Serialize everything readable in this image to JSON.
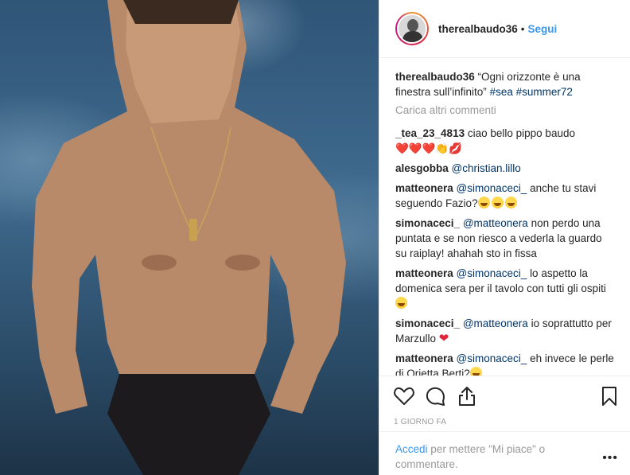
{
  "header": {
    "username": "therealbaudo36",
    "separator": "•",
    "follow_label": "Segui"
  },
  "caption": {
    "username": "therealbaudo36",
    "text": "“Ogni orizzonte è una finestra sull’infinito”",
    "hashtags": [
      "#sea",
      "#summer72"
    ]
  },
  "load_more_label": "Carica altri commenti",
  "comments": [
    {
      "user": "_tea_23_4813",
      "text": "ciao bello pippo baudo",
      "emoji": "❤️❤️❤️👏💋"
    },
    {
      "user": "alesgobba",
      "mention": "@christian.lillo",
      "text": ""
    },
    {
      "user": "matteonera",
      "mention": "@simonaceci_",
      "text": "anche tu stavi seguendo Fazio?",
      "emoji_laugh": 3
    },
    {
      "user": "simonaceci_",
      "mention": "@matteonera",
      "text": "non perdo una puntata e se non riesco a vederla la guardo su raiplay! ahahah sto in fissa"
    },
    {
      "user": "matteonera",
      "mention": "@simonaceci_",
      "text": "lo aspetto la domenica sera per il tavolo con tutti gli ospiti",
      "emoji_laugh": 1
    },
    {
      "user": "simonaceci_",
      "mention": "@matteonera",
      "text": "io soprattutto per Marzullo",
      "heart": "❤"
    },
    {
      "user": "matteonera",
      "mention": "@simonaceci_",
      "text": "eh invece le perle di Orietta Berti?",
      "emoji_laugh": 1
    }
  ],
  "actions": {
    "icons": [
      "heart-icon",
      "comment-icon",
      "share-icon",
      "bookmark-icon"
    ],
    "timestamp": "1 GIORNO FA"
  },
  "footer": {
    "login_label": "Accedi",
    "text": "per mettere \"Mi piace\" o commentare.",
    "more": "•••"
  },
  "colors": {
    "link": "#3897f0",
    "hashtag": "#003569",
    "muted": "#999999"
  }
}
